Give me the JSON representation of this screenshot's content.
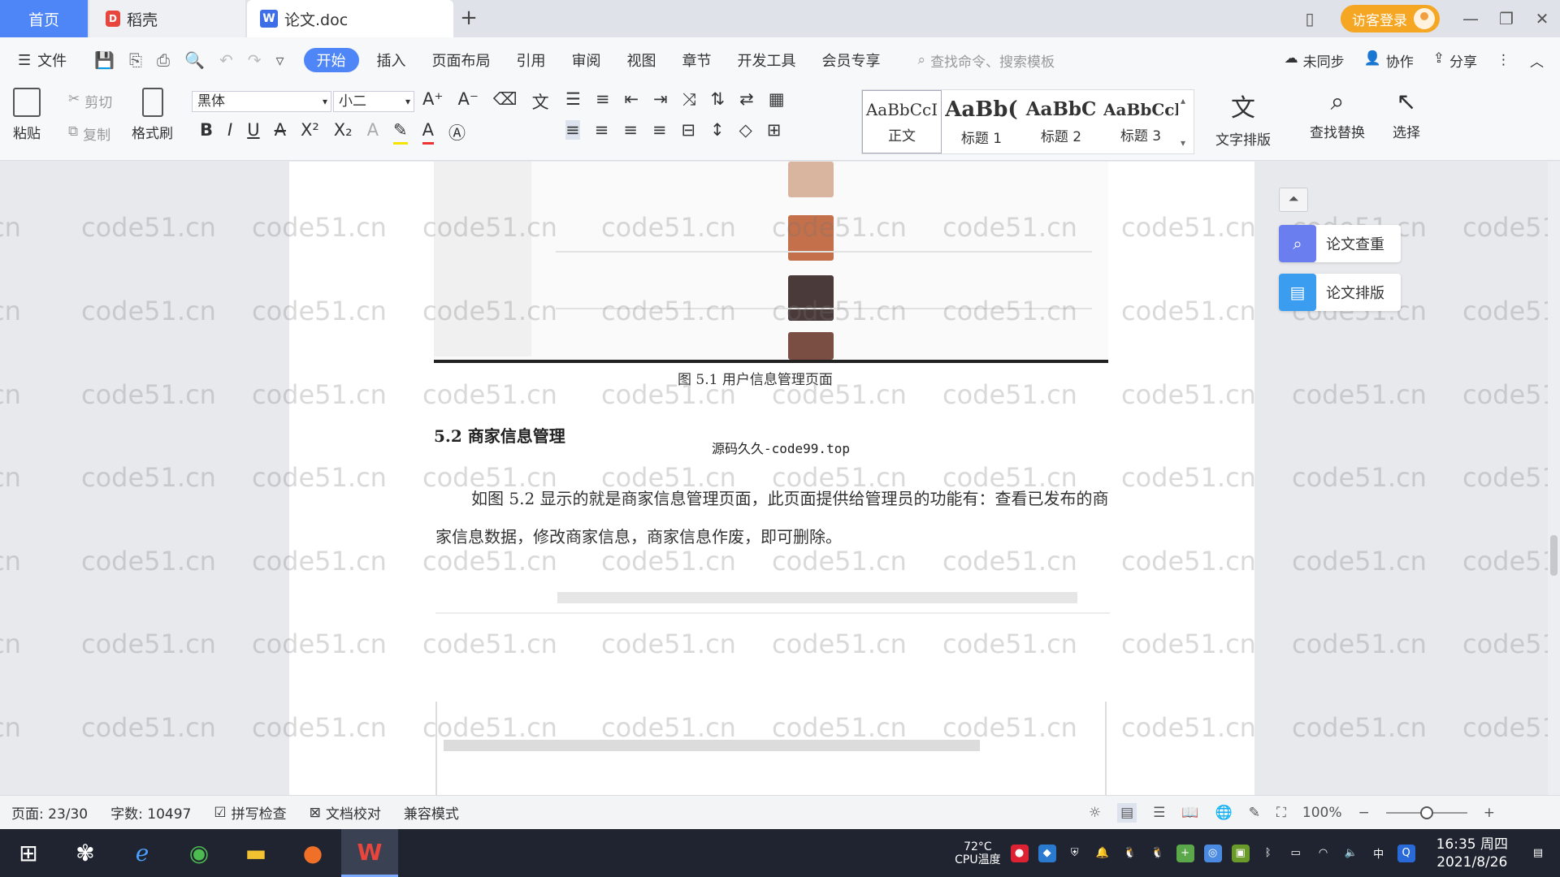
{
  "titlebar": {
    "tab_home": "首页",
    "tab_daoke": "稻壳",
    "tab_doc": "论文.doc",
    "login": "访客登录"
  },
  "menubar": {
    "file": "文件",
    "items": [
      "开始",
      "插入",
      "页面布局",
      "引用",
      "审阅",
      "视图",
      "章节",
      "开发工具",
      "会员专享"
    ],
    "search_placeholder": "查找命令、搜索模板",
    "not_synced": "未同步",
    "collaborate": "协作",
    "share": "分享"
  },
  "ribbon": {
    "paste": "粘贴",
    "cut": "剪切",
    "copy": "复制",
    "format_painter": "格式刷",
    "font_name": "黑体",
    "font_size": "小二",
    "styles": [
      {
        "sample": "AaBbCcI",
        "label": "正文"
      },
      {
        "sample": "AaBb(",
        "label": "标题 1"
      },
      {
        "sample": "AaBbC",
        "label": "标题 2"
      },
      {
        "sample": "AaBbCcl",
        "label": "标题 3"
      }
    ],
    "text_layout": "文字排版",
    "find_replace": "查找替换",
    "select": "选择"
  },
  "document": {
    "watermark": "code51.cn",
    "figure_caption": "图 5.1  用户信息管理页面",
    "section_heading": "5.2  商家信息管理",
    "source_note": "源码久久-code99.top",
    "paragraph": "如图 5.2 显示的就是商家信息管理页面，此页面提供给管理员的功能有：查看已发布的商家信息数据，修改商家信息，商家信息作废，即可删除。"
  },
  "side_panel": {
    "check": "论文查重",
    "layout": "论文排版"
  },
  "statusbar": {
    "page": "页面: 23/30",
    "words": "字数: 10497",
    "spell": "拼写检查",
    "proof": "文档校对",
    "compat": "兼容模式",
    "zoom": "100%",
    "zoom_level": 0.5
  },
  "taskbar": {
    "cpu_temp": "72°C",
    "cpu_label": "CPU温度",
    "ime": "中",
    "time": "16:35 周四",
    "date": "2021/8/26"
  },
  "colors": {
    "accent": "#4f86f7",
    "login": "#f5a623",
    "taskbar": "#1f2430"
  }
}
